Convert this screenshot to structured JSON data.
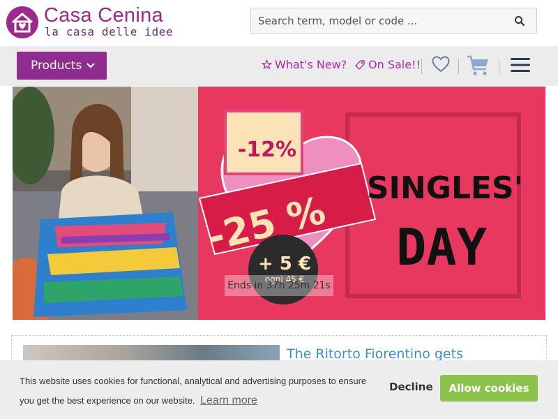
{
  "header": {
    "brand_name": "Casa Cenina",
    "tagline": "la casa delle idee",
    "search_placeholder": "Search term, model or code ..."
  },
  "navbar": {
    "products_label": "Products",
    "whats_new_label": "What's New?",
    "on_sale_label": "On Sale!!",
    "icons": [
      "star-icon",
      "tag-icon",
      "heart-icon",
      "cart-icon",
      "hamburger-menu-icon"
    ]
  },
  "banner": {
    "discount_top": "-12%",
    "discount_main": "-25 %",
    "bonus": "+ 5 €",
    "bonus_sub": "ogni 45 €",
    "headline_word1": "SINGLES'",
    "headline_word2": "DAY",
    "countdown": "Ends in 37h 25m 21s"
  },
  "news": {
    "title": "The Ritorto Fiorentino gets discontinued."
  },
  "cookie_banner": {
    "text": "This website uses cookies for functional, analytical and advertising purposes to ensure you get the best experience on our website.",
    "learn_more_label": "Learn more",
    "decline_label": "Decline",
    "allow_label": "Allow cookies"
  },
  "colors": {
    "brand_purple": "#8e2d8f",
    "link_magenta": "#b02aa7",
    "banner_pink": "#e8385f",
    "allow_green": "#8bc34a",
    "news_blue": "#3a8fd0"
  }
}
